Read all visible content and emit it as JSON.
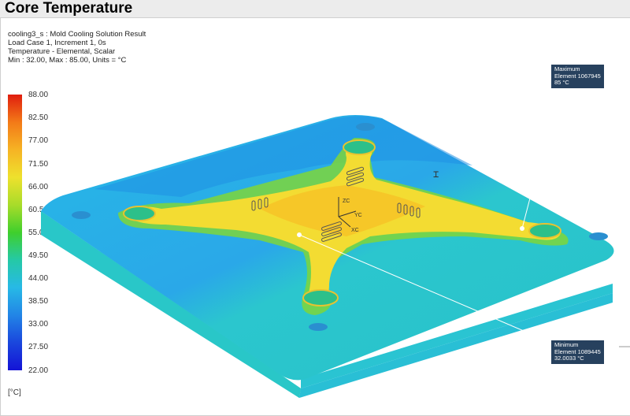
{
  "window": {
    "title": "Core Temperature"
  },
  "info": {
    "line1": "cooling3_s : Mold Cooling Solution Result",
    "line2": "Load Case 1, Increment 1, 0s",
    "line3": "Temperature - Elemental, Scalar",
    "line4": "Min : 32.00, Max : 85.00, Units = °C"
  },
  "legend": {
    "labels": [
      "88.00",
      "82.50",
      "77.00",
      "71.50",
      "66.00",
      "60.50",
      "55.00",
      "49.50",
      "44.00",
      "38.50",
      "33.00",
      "27.50",
      "22.00"
    ],
    "units": "[°C]",
    "colors": [
      "#e01d0e",
      "#f37a18",
      "#f6b324",
      "#eee12d",
      "#a8dc2a",
      "#3fcf2c",
      "#25c9a6",
      "#27b9e6",
      "#2285e6",
      "#1a46dd",
      "#1413d6"
    ]
  },
  "maximum": {
    "label": "Maximum",
    "element": "Element 1067945",
    "value": "85 °C"
  },
  "minimum": {
    "label": "Minimum",
    "element": "Element 1089445",
    "value": "32.0033 °C"
  },
  "triad": {
    "zc": "ZC",
    "yc": "YC",
    "xc": "XC"
  },
  "cursor_icon": "text-cursor-icon"
}
